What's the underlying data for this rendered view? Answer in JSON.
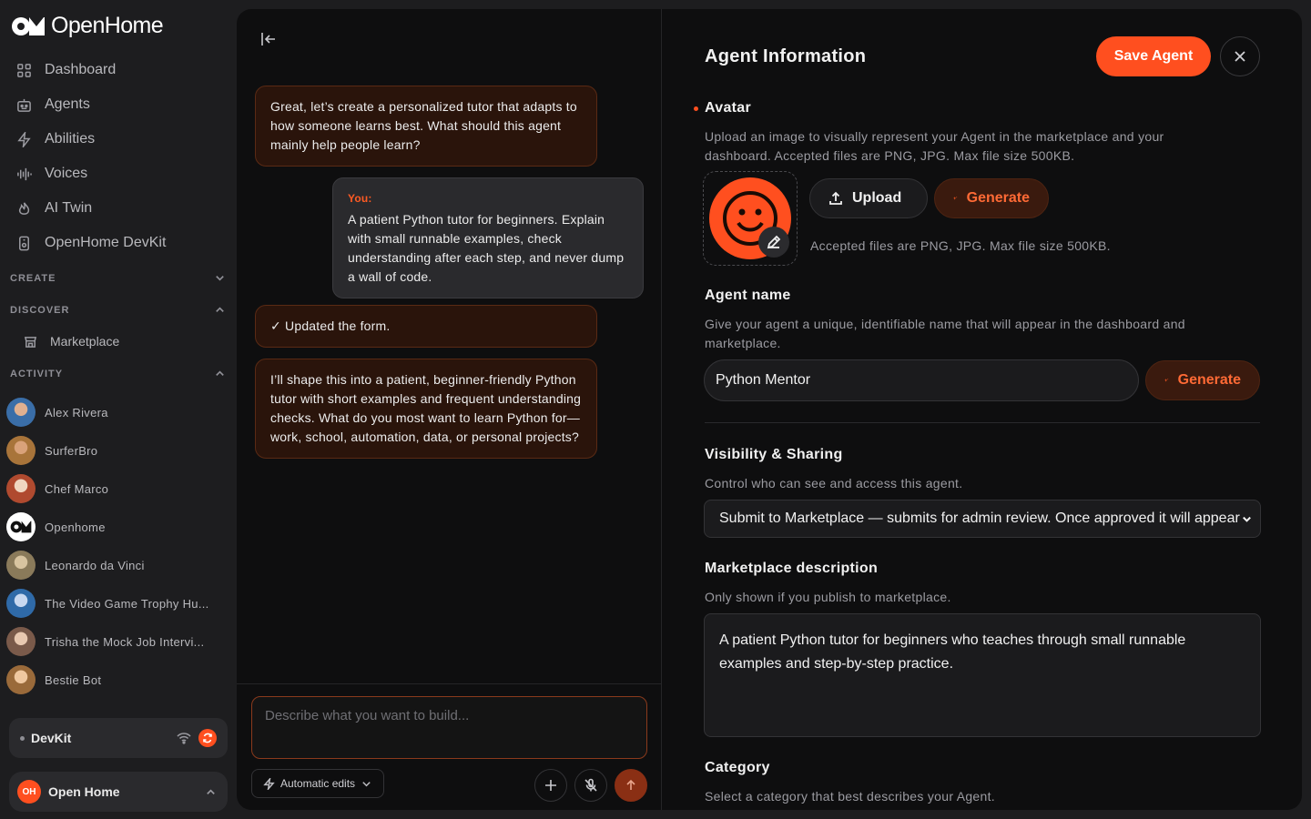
{
  "brand": {
    "name": "OpenHome"
  },
  "sidebar": {
    "nav": [
      {
        "label": "Dashboard",
        "icon": "grid-icon"
      },
      {
        "label": "Agents",
        "icon": "robot-icon"
      },
      {
        "label": "Abilities",
        "icon": "lightning-icon"
      },
      {
        "label": "Voices",
        "icon": "waveform-icon"
      },
      {
        "label": "AI Twin",
        "icon": "flame-icon"
      },
      {
        "label": "OpenHome DevKit",
        "icon": "device-icon"
      }
    ],
    "sections": {
      "create": "CREATE",
      "discover": "DISCOVER",
      "activity": "ACTIVITY"
    },
    "marketplace": "Marketplace",
    "activity": [
      {
        "label": "Alex Rivera",
        "color": "#3a6ea8"
      },
      {
        "label": "SurferBro",
        "color": "#a8743a"
      },
      {
        "label": "Chef Marco",
        "color": "#b04a2f"
      },
      {
        "label": "Openhome",
        "color": "#ffffff"
      },
      {
        "label": "Leonardo da Vinci",
        "color": "#8a7a5a"
      },
      {
        "label": "The Video Game Trophy Hu...",
        "color": "#2f6aa8"
      },
      {
        "label": "Trisha the Mock Job Intervi...",
        "color": "#7a5a4a"
      },
      {
        "label": "Bestie Bot",
        "color": "#9a6a3a"
      }
    ],
    "devkit": "DevKit",
    "account": {
      "initials": "OH",
      "name": "Open Home"
    }
  },
  "chat": {
    "messages": [
      {
        "role": "assistant",
        "text": "Great, let’s create a personalized tutor that adapts to how someone learns best. What should this agent mainly help people learn?"
      },
      {
        "role": "user",
        "prefix": "You:",
        "text": "A patient Python tutor for beginners. Explain with small runnable examples, check understanding after each step, and never dump a wall of code."
      },
      {
        "role": "assistant",
        "text": "✓ Updated the form."
      },
      {
        "role": "assistant",
        "text": "I’ll shape this into a patient, beginner-friendly Python tutor with short examples and frequent understanding checks. What do you most want to learn Python for—work, school, automation, data, or personal projects?"
      }
    ],
    "composer_placeholder": "Describe what you want to build...",
    "auto_edits": "Automatic edits"
  },
  "form": {
    "title": "Agent Information",
    "save": "Save Agent",
    "avatar": {
      "label": "Avatar",
      "help": "Upload an image to visually represent your Agent in the marketplace and your dashboard. Accepted files are PNG, JPG. Max file size 500KB.",
      "upload": "Upload",
      "generate": "Generate",
      "small_help": "Accepted files are PNG, JPG. Max file size 500KB."
    },
    "name": {
      "label": "Agent name",
      "help": "Give your agent a unique, identifiable name that will appear in the dashboard and marketplace.",
      "value": "Python Mentor",
      "generate": "Generate"
    },
    "visibility": {
      "label": "Visibility & Sharing",
      "help": "Control who can see and access this agent.",
      "value": "Submit to Marketplace — submits for admin review. Once approved it will appear"
    },
    "description": {
      "label": "Marketplace description",
      "help": "Only shown if you publish to marketplace.",
      "value": "A patient Python tutor for beginners who teaches through small runnable examples and step-by-step practice."
    },
    "category": {
      "label": "Category",
      "help": "Select a category that best describes your Agent."
    }
  },
  "colors": {
    "accent": "#ff4f1f",
    "background": "#0e0e0f",
    "sidebar": "#1d1d1f"
  }
}
